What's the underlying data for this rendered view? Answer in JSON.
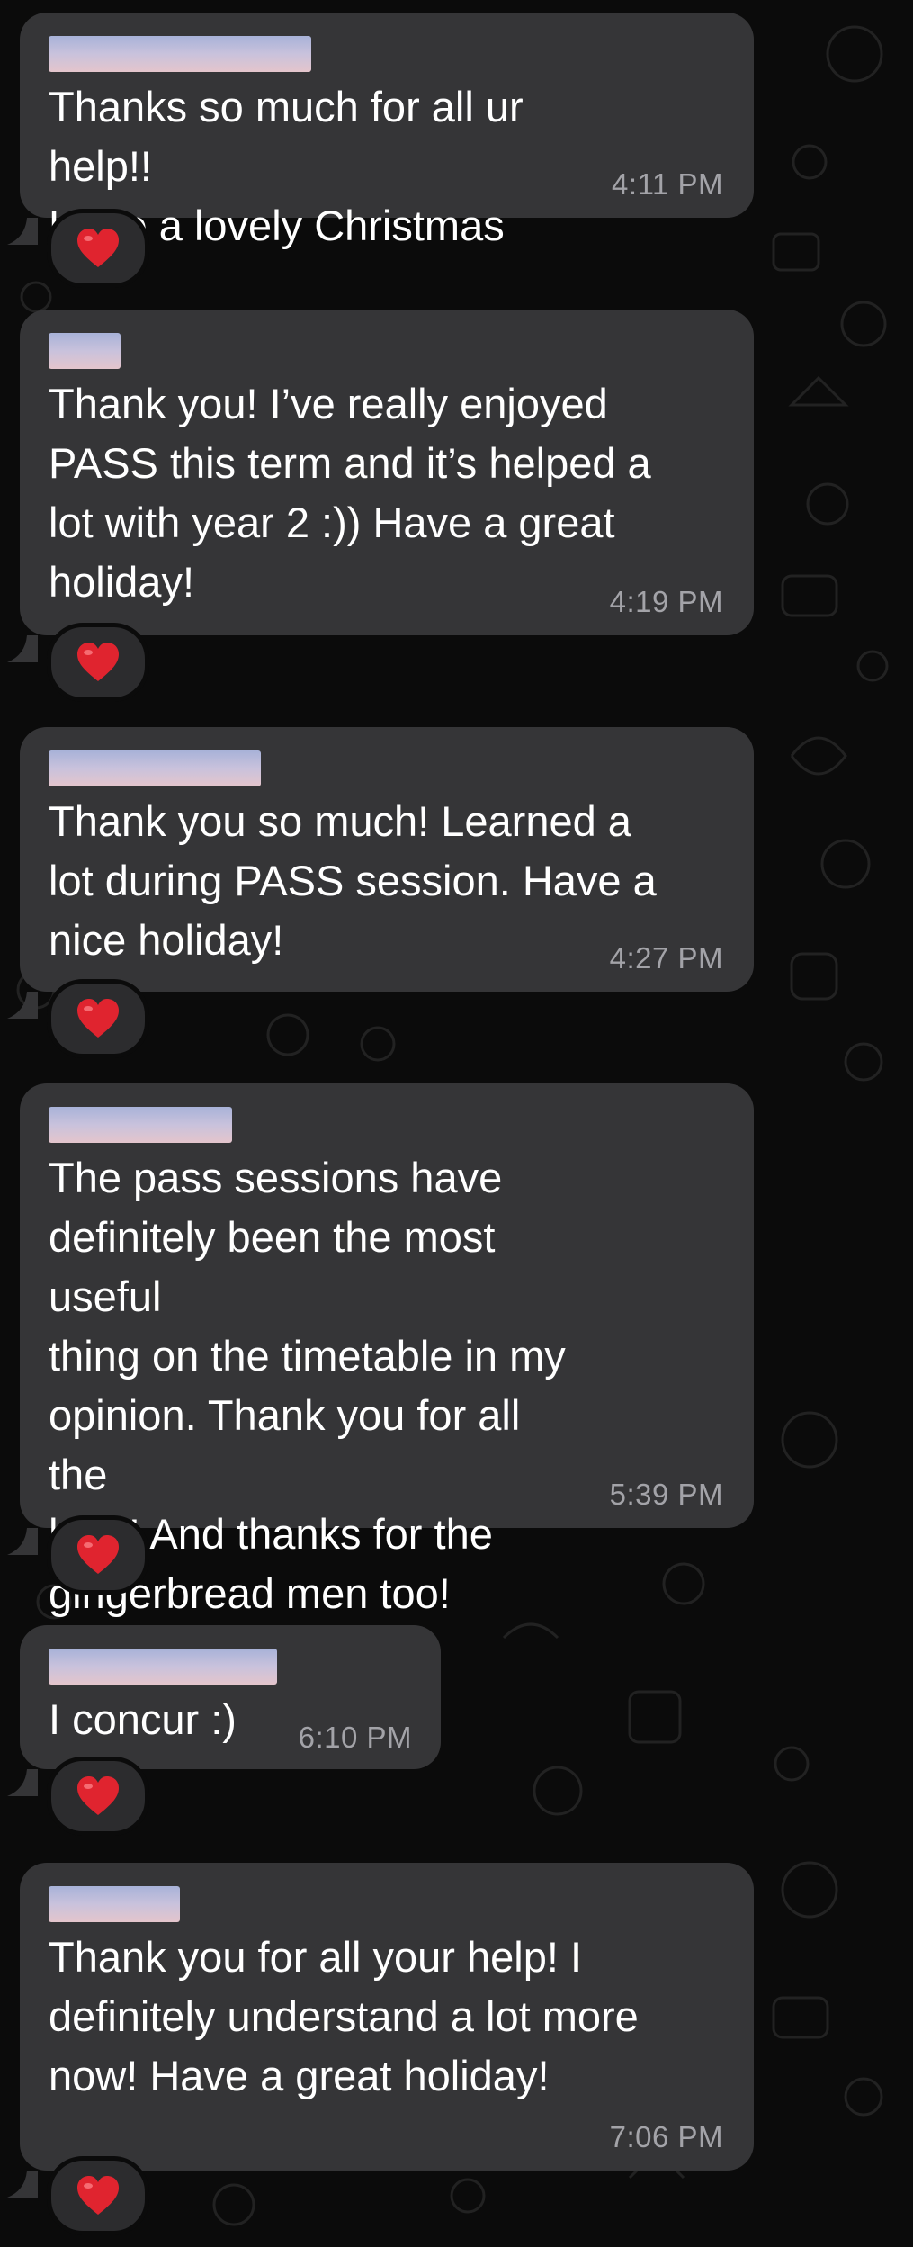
{
  "colors": {
    "background": "#0b0b0b",
    "bubble": "#353537",
    "text": "#ffffff",
    "timestamp": "#a3a3a8",
    "reaction_bg": "#2c2c2e",
    "heart": "#e0242f"
  },
  "messages": [
    {
      "text": "Thanks so much for all ur help!!\nHave a lovely Christmas",
      "time": "4:11 PM",
      "reaction": "heart-icon"
    },
    {
      "text": "Thank you! I’ve really enjoyed\nPASS this term and it’s helped a\nlot with year 2 :)) Have a great\nholiday!",
      "time": "4:19 PM",
      "reaction": "heart-icon"
    },
    {
      "text": "Thank you so much! Learned a\nlot during PASS session. Have a\nnice holiday!",
      "time": "4:27 PM",
      "reaction": "heart-icon"
    },
    {
      "text": "The pass sessions have\ndefinitely been the most useful\nthing on the timetable in my\nopinion. Thank you for all the\nhelp! And thanks for the\ngingerbread men too!",
      "time": "5:39 PM",
      "reaction": "heart-icon"
    },
    {
      "text": "I concur :)",
      "time": "6:10 PM",
      "reaction": "heart-icon"
    },
    {
      "text": "Thank you for all your help! I\ndefinitely understand a lot more\nnow! Have a great holiday!",
      "time": "7:06 PM",
      "reaction": "heart-icon"
    }
  ]
}
